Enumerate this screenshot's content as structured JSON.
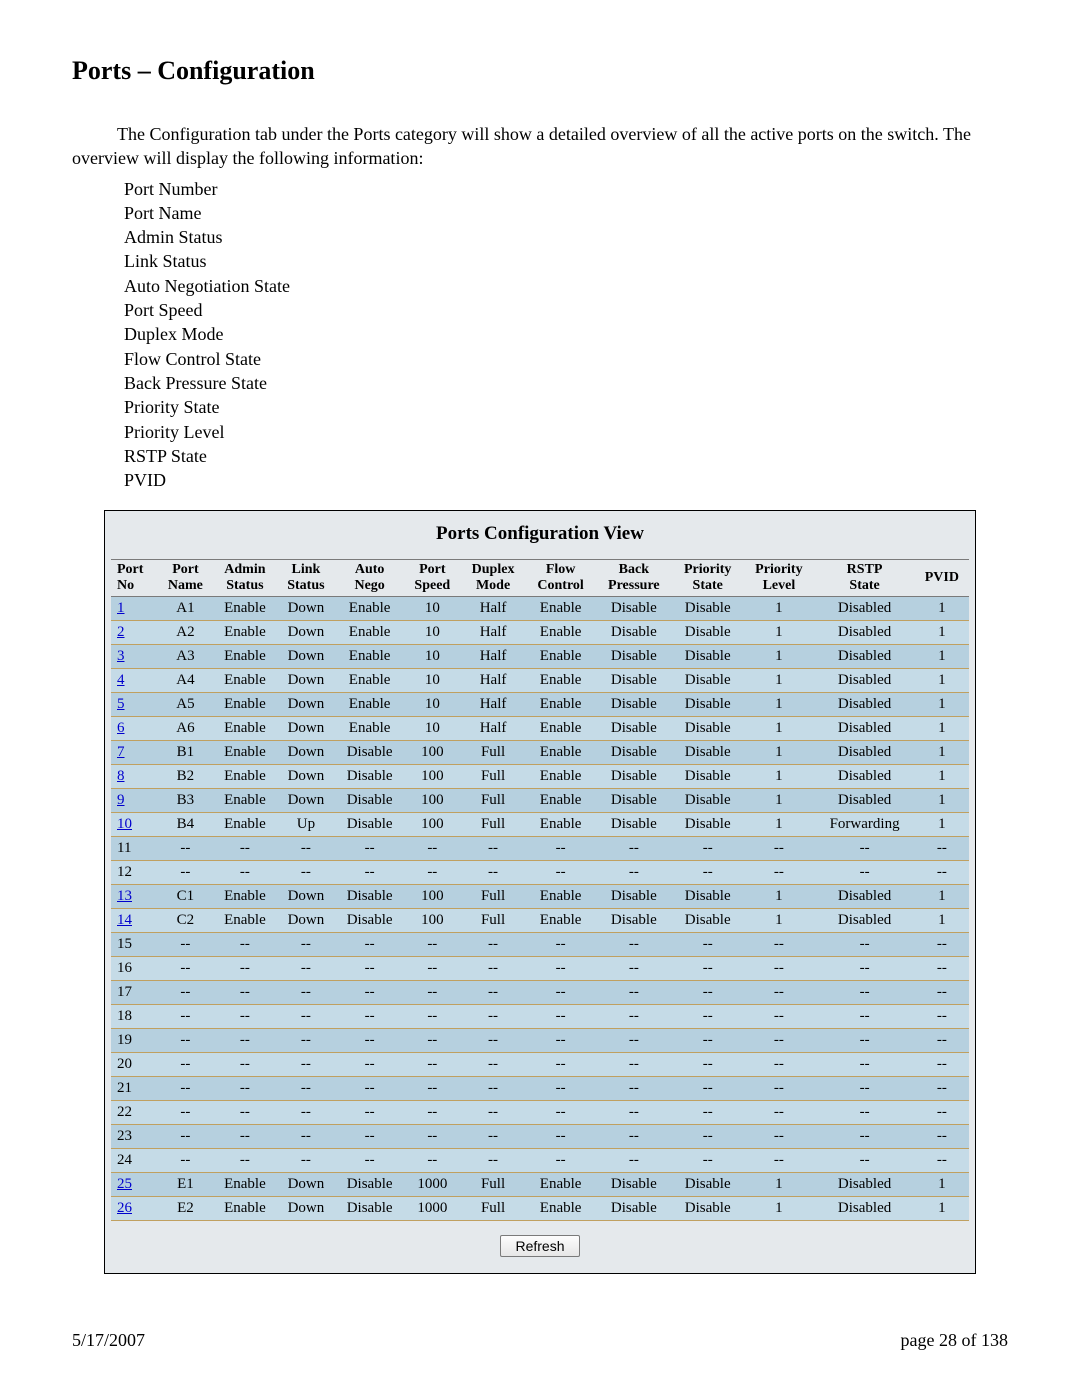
{
  "heading": "Ports – Configuration",
  "intro": "The Configuration tab under the Ports category will show a detailed overview of all the active ports on the switch.  The overview will display the following information:",
  "info_items": [
    "Port Number",
    "Port Name",
    "Admin Status",
    "Link Status",
    "Auto Negotiation State",
    "Port Speed",
    "Duplex Mode",
    "Flow Control State",
    "Back Pressure State",
    "Priority State",
    "Priority Level",
    "RSTP State",
    "PVID"
  ],
  "panel_title": "Ports Configuration View",
  "columns": [
    "Port No",
    "Port Name",
    "Admin Status",
    "Link Status",
    "Auto Nego",
    "Port Speed",
    "Duplex Mode",
    "Flow Control",
    "Back Pressure",
    "Priority State",
    "Priority Level",
    "RSTP State",
    "PVID"
  ],
  "rows": [
    {
      "no": "1",
      "link": true,
      "name": "A1",
      "admin": "Enable",
      "lstat": "Down",
      "nego": "Enable",
      "speed": "10",
      "duplex": "Half",
      "flow": "Enable",
      "back": "Disable",
      "pstate": "Disable",
      "plevel": "1",
      "rstp": "Disabled",
      "pvid": "1"
    },
    {
      "no": "2",
      "link": true,
      "name": "A2",
      "admin": "Enable",
      "lstat": "Down",
      "nego": "Enable",
      "speed": "10",
      "duplex": "Half",
      "flow": "Enable",
      "back": "Disable",
      "pstate": "Disable",
      "plevel": "1",
      "rstp": "Disabled",
      "pvid": "1"
    },
    {
      "no": "3",
      "link": true,
      "name": "A3",
      "admin": "Enable",
      "lstat": "Down",
      "nego": "Enable",
      "speed": "10",
      "duplex": "Half",
      "flow": "Enable",
      "back": "Disable",
      "pstate": "Disable",
      "plevel": "1",
      "rstp": "Disabled",
      "pvid": "1"
    },
    {
      "no": "4",
      "link": true,
      "name": "A4",
      "admin": "Enable",
      "lstat": "Down",
      "nego": "Enable",
      "speed": "10",
      "duplex": "Half",
      "flow": "Enable",
      "back": "Disable",
      "pstate": "Disable",
      "plevel": "1",
      "rstp": "Disabled",
      "pvid": "1"
    },
    {
      "no": "5",
      "link": true,
      "name": "A5",
      "admin": "Enable",
      "lstat": "Down",
      "nego": "Enable",
      "speed": "10",
      "duplex": "Half",
      "flow": "Enable",
      "back": "Disable",
      "pstate": "Disable",
      "plevel": "1",
      "rstp": "Disabled",
      "pvid": "1"
    },
    {
      "no": "6",
      "link": true,
      "name": "A6",
      "admin": "Enable",
      "lstat": "Down",
      "nego": "Enable",
      "speed": "10",
      "duplex": "Half",
      "flow": "Enable",
      "back": "Disable",
      "pstate": "Disable",
      "plevel": "1",
      "rstp": "Disabled",
      "pvid": "1"
    },
    {
      "no": "7",
      "link": true,
      "name": "B1",
      "admin": "Enable",
      "lstat": "Down",
      "nego": "Disable",
      "speed": "100",
      "duplex": "Full",
      "flow": "Enable",
      "back": "Disable",
      "pstate": "Disable",
      "plevel": "1",
      "rstp": "Disabled",
      "pvid": "1"
    },
    {
      "no": "8",
      "link": true,
      "name": "B2",
      "admin": "Enable",
      "lstat": "Down",
      "nego": "Disable",
      "speed": "100",
      "duplex": "Full",
      "flow": "Enable",
      "back": "Disable",
      "pstate": "Disable",
      "plevel": "1",
      "rstp": "Disabled",
      "pvid": "1"
    },
    {
      "no": "9",
      "link": true,
      "name": "B3",
      "admin": "Enable",
      "lstat": "Down",
      "nego": "Disable",
      "speed": "100",
      "duplex": "Full",
      "flow": "Enable",
      "back": "Disable",
      "pstate": "Disable",
      "plevel": "1",
      "rstp": "Disabled",
      "pvid": "1"
    },
    {
      "no": "10",
      "link": true,
      "name": "B4",
      "admin": "Enable",
      "lstat": "Up",
      "nego": "Disable",
      "speed": "100",
      "duplex": "Full",
      "flow": "Enable",
      "back": "Disable",
      "pstate": "Disable",
      "plevel": "1",
      "rstp": "Forwarding",
      "pvid": "1"
    },
    {
      "no": "11",
      "link": false,
      "name": "--",
      "admin": "--",
      "lstat": "--",
      "nego": "--",
      "speed": "--",
      "duplex": "--",
      "flow": "--",
      "back": "--",
      "pstate": "--",
      "plevel": "--",
      "rstp": "--",
      "pvid": "--"
    },
    {
      "no": "12",
      "link": false,
      "name": "--",
      "admin": "--",
      "lstat": "--",
      "nego": "--",
      "speed": "--",
      "duplex": "--",
      "flow": "--",
      "back": "--",
      "pstate": "--",
      "plevel": "--",
      "rstp": "--",
      "pvid": "--"
    },
    {
      "no": "13",
      "link": true,
      "name": "C1",
      "admin": "Enable",
      "lstat": "Down",
      "nego": "Disable",
      "speed": "100",
      "duplex": "Full",
      "flow": "Enable",
      "back": "Disable",
      "pstate": "Disable",
      "plevel": "1",
      "rstp": "Disabled",
      "pvid": "1"
    },
    {
      "no": "14",
      "link": true,
      "name": "C2",
      "admin": "Enable",
      "lstat": "Down",
      "nego": "Disable",
      "speed": "100",
      "duplex": "Full",
      "flow": "Enable",
      "back": "Disable",
      "pstate": "Disable",
      "plevel": "1",
      "rstp": "Disabled",
      "pvid": "1"
    },
    {
      "no": "15",
      "link": false,
      "name": "--",
      "admin": "--",
      "lstat": "--",
      "nego": "--",
      "speed": "--",
      "duplex": "--",
      "flow": "--",
      "back": "--",
      "pstate": "--",
      "plevel": "--",
      "rstp": "--",
      "pvid": "--"
    },
    {
      "no": "16",
      "link": false,
      "name": "--",
      "admin": "--",
      "lstat": "--",
      "nego": "--",
      "speed": "--",
      "duplex": "--",
      "flow": "--",
      "back": "--",
      "pstate": "--",
      "plevel": "--",
      "rstp": "--",
      "pvid": "--"
    },
    {
      "no": "17",
      "link": false,
      "name": "--",
      "admin": "--",
      "lstat": "--",
      "nego": "--",
      "speed": "--",
      "duplex": "--",
      "flow": "--",
      "back": "--",
      "pstate": "--",
      "plevel": "--",
      "rstp": "--",
      "pvid": "--"
    },
    {
      "no": "18",
      "link": false,
      "name": "--",
      "admin": "--",
      "lstat": "--",
      "nego": "--",
      "speed": "--",
      "duplex": "--",
      "flow": "--",
      "back": "--",
      "pstate": "--",
      "plevel": "--",
      "rstp": "--",
      "pvid": "--"
    },
    {
      "no": "19",
      "link": false,
      "name": "--",
      "admin": "--",
      "lstat": "--",
      "nego": "--",
      "speed": "--",
      "duplex": "--",
      "flow": "--",
      "back": "--",
      "pstate": "--",
      "plevel": "--",
      "rstp": "--",
      "pvid": "--"
    },
    {
      "no": "20",
      "link": false,
      "name": "--",
      "admin": "--",
      "lstat": "--",
      "nego": "--",
      "speed": "--",
      "duplex": "--",
      "flow": "--",
      "back": "--",
      "pstate": "--",
      "plevel": "--",
      "rstp": "--",
      "pvid": "--"
    },
    {
      "no": "21",
      "link": false,
      "name": "--",
      "admin": "--",
      "lstat": "--",
      "nego": "--",
      "speed": "--",
      "duplex": "--",
      "flow": "--",
      "back": "--",
      "pstate": "--",
      "plevel": "--",
      "rstp": "--",
      "pvid": "--"
    },
    {
      "no": "22",
      "link": false,
      "name": "--",
      "admin": "--",
      "lstat": "--",
      "nego": "--",
      "speed": "--",
      "duplex": "--",
      "flow": "--",
      "back": "--",
      "pstate": "--",
      "plevel": "--",
      "rstp": "--",
      "pvid": "--"
    },
    {
      "no": "23",
      "link": false,
      "name": "--",
      "admin": "--",
      "lstat": "--",
      "nego": "--",
      "speed": "--",
      "duplex": "--",
      "flow": "--",
      "back": "--",
      "pstate": "--",
      "plevel": "--",
      "rstp": "--",
      "pvid": "--"
    },
    {
      "no": "24",
      "link": false,
      "name": "--",
      "admin": "--",
      "lstat": "--",
      "nego": "--",
      "speed": "--",
      "duplex": "--",
      "flow": "--",
      "back": "--",
      "pstate": "--",
      "plevel": "--",
      "rstp": "--",
      "pvid": "--"
    },
    {
      "no": "25",
      "link": true,
      "name": "E1",
      "admin": "Enable",
      "lstat": "Down",
      "nego": "Disable",
      "speed": "1000",
      "duplex": "Full",
      "flow": "Enable",
      "back": "Disable",
      "pstate": "Disable",
      "plevel": "1",
      "rstp": "Disabled",
      "pvid": "1"
    },
    {
      "no": "26",
      "link": true,
      "name": "E2",
      "admin": "Enable",
      "lstat": "Down",
      "nego": "Disable",
      "speed": "1000",
      "duplex": "Full",
      "flow": "Enable",
      "back": "Disable",
      "pstate": "Disable",
      "plevel": "1",
      "rstp": "Disabled",
      "pvid": "1"
    }
  ],
  "refresh_label": "Refresh",
  "footer_date": "5/17/2007",
  "footer_page": "page 28 of 138"
}
